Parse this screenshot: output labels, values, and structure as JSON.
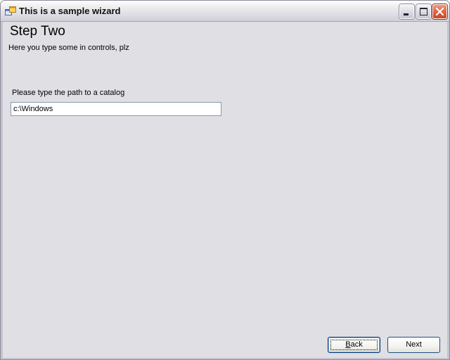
{
  "window": {
    "title": "This is a sample wizard"
  },
  "titlebar": {
    "icon": "application-icon",
    "buttons": [
      "minimize-icon",
      "maximize-icon",
      "close-icon"
    ]
  },
  "wizard": {
    "step_title": "Step Two",
    "step_subtitle": "Here you type some in controls, plz",
    "path_label": "Please type the path to a catalog",
    "path_value": "c:\\Windows"
  },
  "footer": {
    "back_first": "B",
    "back_rest": "ack",
    "next_label": "Next"
  },
  "colors": {
    "client_background": "#e0dfe3",
    "close_button": "#e1603d",
    "input_border": "#7f9db9",
    "button_border": "#003c74"
  }
}
